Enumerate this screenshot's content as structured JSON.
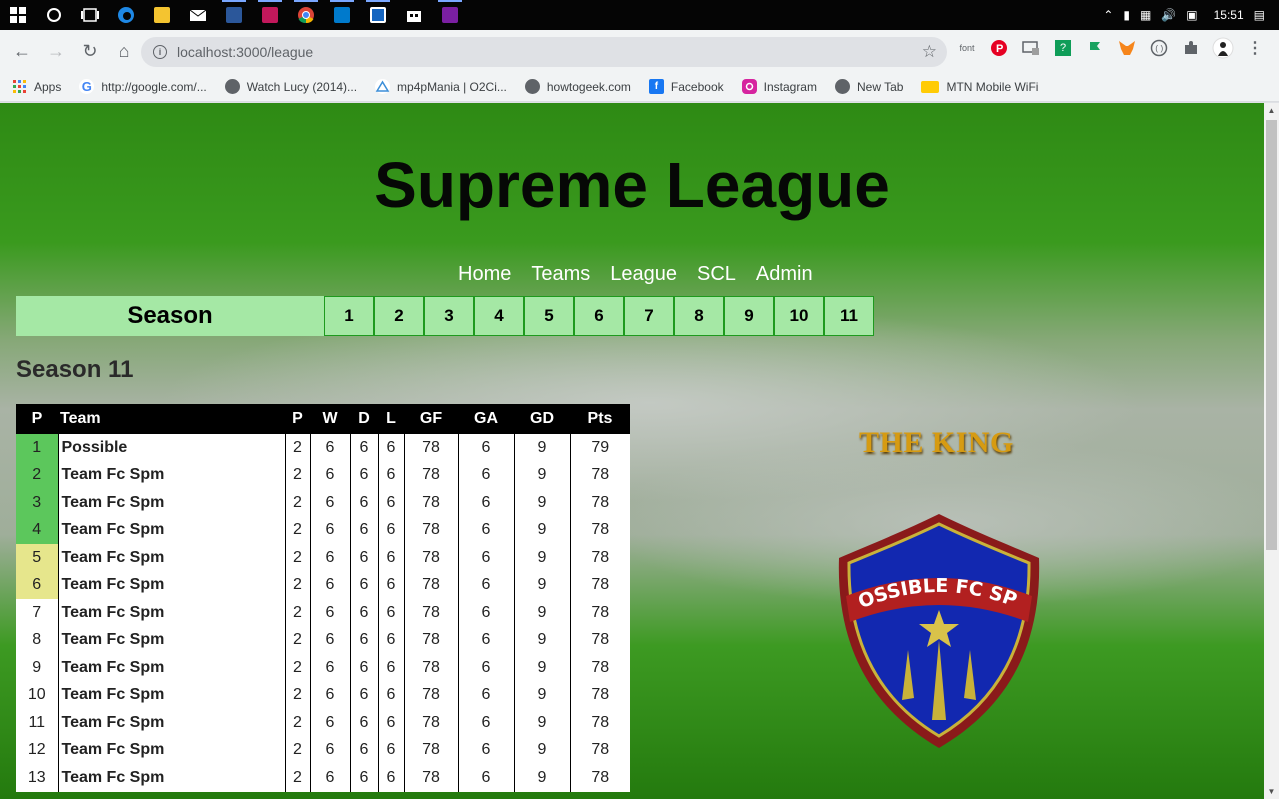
{
  "taskbar": {
    "icons": [
      "windows-start-icon",
      "search-circle-icon",
      "task-view-icon",
      "edge-icon",
      "file-explorer-icon",
      "mail-icon",
      "word-icon",
      "app-icon",
      "chrome-icon",
      "vscode-icon",
      "app-icon",
      "store-icon",
      "app-icon"
    ],
    "time": "15:51"
  },
  "browser": {
    "url": "localhost:3000/league",
    "bookmarks": [
      {
        "label": "Apps",
        "icon": "apps-grid-icon",
        "color": "#ea4335"
      },
      {
        "label": "http://google.com/...",
        "icon": "google-icon",
        "color": "#4285f4"
      },
      {
        "label": "Watch Lucy (2014)...",
        "icon": "globe-icon",
        "color": "#5f6368"
      },
      {
        "label": "mp4pMania | O2Ci...",
        "icon": "mp4pmania-icon",
        "color": "#3b8ed8"
      },
      {
        "label": "howtogeek.com",
        "icon": "globe-icon",
        "color": "#5f6368"
      },
      {
        "label": "Facebook",
        "icon": "facebook-icon",
        "color": "#1877f2"
      },
      {
        "label": "Instagram",
        "icon": "instagram-icon",
        "color": "#d6249f"
      },
      {
        "label": "New Tab",
        "icon": "globe-icon",
        "color": "#5f6368"
      },
      {
        "label": "MTN Mobile WiFi",
        "icon": "mtn-icon",
        "color": "#ffcb05"
      }
    ],
    "extensions": [
      "font",
      "pinterest",
      "cast",
      "help",
      "flag",
      "metamask",
      "code",
      "puzzle",
      "profile"
    ]
  },
  "page": {
    "title": "Supreme League",
    "nav": [
      "Home",
      "Teams",
      "League",
      "SCL",
      "Admin"
    ],
    "season_label": "Season",
    "seasons": [
      "1",
      "2",
      "3",
      "4",
      "5",
      "6",
      "7",
      "8",
      "9",
      "10",
      "11"
    ],
    "current_season": "Season 11",
    "table": {
      "headers": [
        "P",
        "Team",
        "P",
        "W",
        "D",
        "L",
        "GF",
        "GA",
        "GD",
        "Pts"
      ],
      "rows": [
        {
          "pos": "1",
          "team": "Possible",
          "p": "2",
          "w": "6",
          "d": "6",
          "l": "6",
          "gf": "78",
          "ga": "6",
          "gd": "9",
          "pts": "79",
          "zone": "promotion"
        },
        {
          "pos": "2",
          "team": "Team Fc Spm",
          "p": "2",
          "w": "6",
          "d": "6",
          "l": "6",
          "gf": "78",
          "ga": "6",
          "gd": "9",
          "pts": "78",
          "zone": "promotion"
        },
        {
          "pos": "3",
          "team": "Team Fc Spm",
          "p": "2",
          "w": "6",
          "d": "6",
          "l": "6",
          "gf": "78",
          "ga": "6",
          "gd": "9",
          "pts": "78",
          "zone": "promotion"
        },
        {
          "pos": "4",
          "team": "Team Fc Spm",
          "p": "2",
          "w": "6",
          "d": "6",
          "l": "6",
          "gf": "78",
          "ga": "6",
          "gd": "9",
          "pts": "78",
          "zone": "promotion"
        },
        {
          "pos": "5",
          "team": "Team Fc Spm",
          "p": "2",
          "w": "6",
          "d": "6",
          "l": "6",
          "gf": "78",
          "ga": "6",
          "gd": "9",
          "pts": "78",
          "zone": "europa"
        },
        {
          "pos": "6",
          "team": "Team Fc Spm",
          "p": "2",
          "w": "6",
          "d": "6",
          "l": "6",
          "gf": "78",
          "ga": "6",
          "gd": "9",
          "pts": "78",
          "zone": "europa"
        },
        {
          "pos": "7",
          "team": "Team Fc Spm",
          "p": "2",
          "w": "6",
          "d": "6",
          "l": "6",
          "gf": "78",
          "ga": "6",
          "gd": "9",
          "pts": "78",
          "zone": "none"
        },
        {
          "pos": "8",
          "team": "Team Fc Spm",
          "p": "2",
          "w": "6",
          "d": "6",
          "l": "6",
          "gf": "78",
          "ga": "6",
          "gd": "9",
          "pts": "78",
          "zone": "none"
        },
        {
          "pos": "9",
          "team": "Team Fc Spm",
          "p": "2",
          "w": "6",
          "d": "6",
          "l": "6",
          "gf": "78",
          "ga": "6",
          "gd": "9",
          "pts": "78",
          "zone": "none"
        },
        {
          "pos": "10",
          "team": "Team Fc Spm",
          "p": "2",
          "w": "6",
          "d": "6",
          "l": "6",
          "gf": "78",
          "ga": "6",
          "gd": "9",
          "pts": "78",
          "zone": "none"
        },
        {
          "pos": "11",
          "team": "Team Fc Spm",
          "p": "2",
          "w": "6",
          "d": "6",
          "l": "6",
          "gf": "78",
          "ga": "6",
          "gd": "9",
          "pts": "78",
          "zone": "none"
        },
        {
          "pos": "12",
          "team": "Team Fc Spm",
          "p": "2",
          "w": "6",
          "d": "6",
          "l": "6",
          "gf": "78",
          "ga": "6",
          "gd": "9",
          "pts": "78",
          "zone": "none"
        },
        {
          "pos": "13",
          "team": "Team Fc Spm",
          "p": "2",
          "w": "6",
          "d": "6",
          "l": "6",
          "gf": "78",
          "ga": "6",
          "gd": "9",
          "pts": "78",
          "zone": "none"
        }
      ]
    },
    "zone_colors": {
      "promotion": "#5cc75c",
      "europa": "#e6e68c",
      "none": "#ffffff"
    },
    "king_title": "THE KING",
    "crest_text": "POSSIBLE FC SPM"
  }
}
